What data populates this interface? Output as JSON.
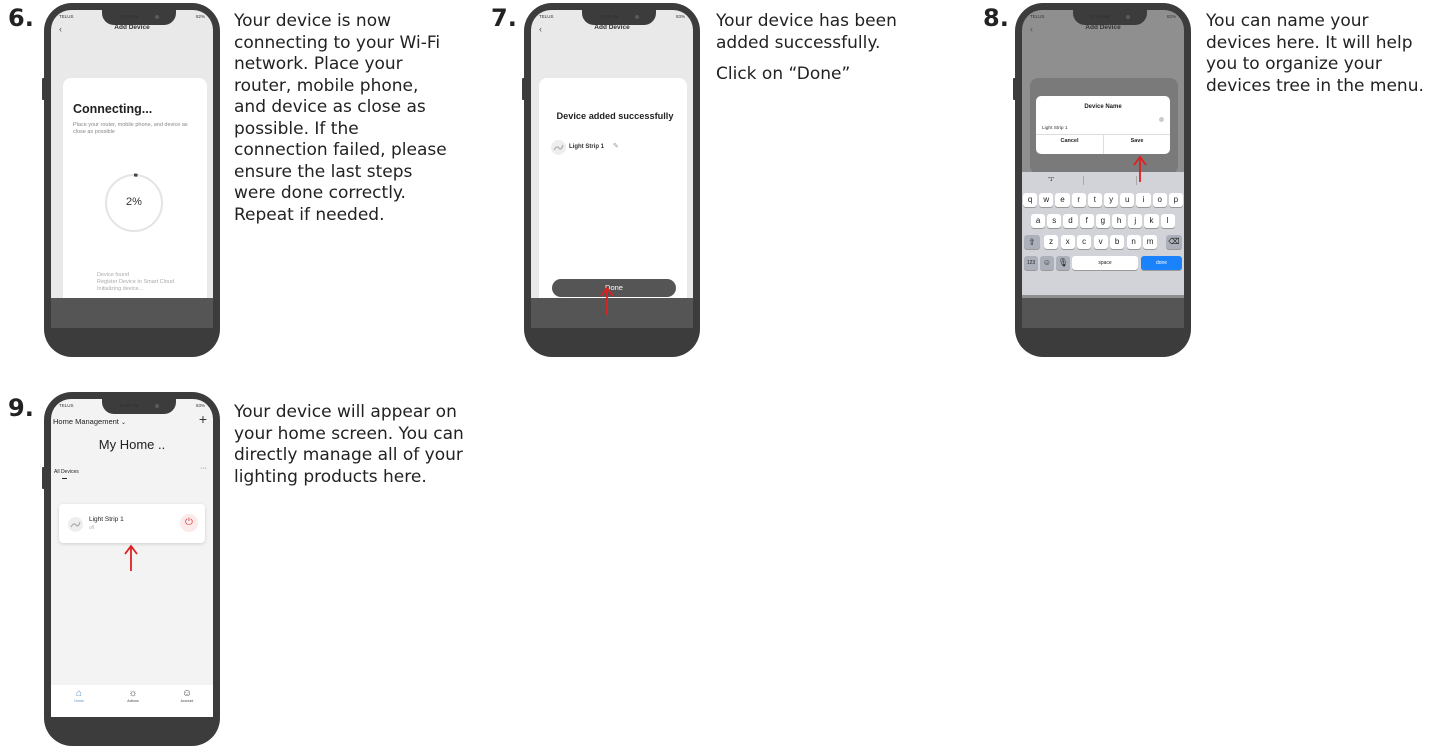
{
  "steps": {
    "s6": {
      "number": "6.",
      "description": "Your device is now connecting to your Wi-Fi network. Place your router, mobile phone, and device as close as possible. If the connection failed, please ensure the last steps were done correctly. Repeat if needed.",
      "phone": {
        "carrier": "TELUS",
        "time": "11:37 AM",
        "battery": "82%",
        "nav_title": "Add Device",
        "heading": "Connecting...",
        "hint": "Place your router, mobile phone, and device as close as possible",
        "progress": "2%",
        "progress_fraction": 0.02,
        "log": [
          "Device found",
          "Register Device to Smart Cloud",
          "Initializing device..."
        ]
      }
    },
    "s7": {
      "number": "7.",
      "desc_line1": "Your device has been added successfully.",
      "desc_line2": "Click on “Done”",
      "phone": {
        "carrier": "TELUS",
        "time": "11:38 AM",
        "battery": "83%",
        "nav_title": "Add Device",
        "heading": "Device added successfully",
        "device_name": "Light Strip 1",
        "done_label": "Done"
      }
    },
    "s8": {
      "number": "8.",
      "description": "You can name your devices here. It will help you to organize your devices tree in the menu.",
      "phone": {
        "carrier": "TELUS",
        "time": "11:40 AM",
        "battery": "82%",
        "nav_title": "Add Device",
        "dialog_title": "Device Name",
        "name_value": "Light Strip 1",
        "cancel_label": "Cancel",
        "save_label": "Save",
        "suggestion": "\"1\"",
        "row1": [
          "q",
          "w",
          "e",
          "r",
          "t",
          "y",
          "u",
          "i",
          "o",
          "p"
        ],
        "row2": [
          "a",
          "s",
          "d",
          "f",
          "g",
          "h",
          "j",
          "k",
          "l"
        ],
        "row3": [
          "z",
          "x",
          "c",
          "v",
          "b",
          "n",
          "m"
        ],
        "key_123": "123",
        "key_space": "space",
        "key_done": "done"
      }
    },
    "s9": {
      "number": "9.",
      "description": "Your device will appear on your home screen. You can directly manage all of your lighting products here.",
      "phone": {
        "carrier": "TELUS",
        "time": "11:52 AM",
        "battery": "83%",
        "home_menu": "Home Management",
        "home_title": "My Home ..",
        "section": "All Devices",
        "device_name": "Light Strip 1",
        "device_state": "off",
        "tab_home": "Home",
        "tab_actions": "Actions",
        "tab_account": "Account"
      }
    }
  },
  "colors": {
    "arrow": "#e02020",
    "frame": "#3c3c3c",
    "accent_blue": "#1a82fb",
    "power_red": "#e04040"
  }
}
